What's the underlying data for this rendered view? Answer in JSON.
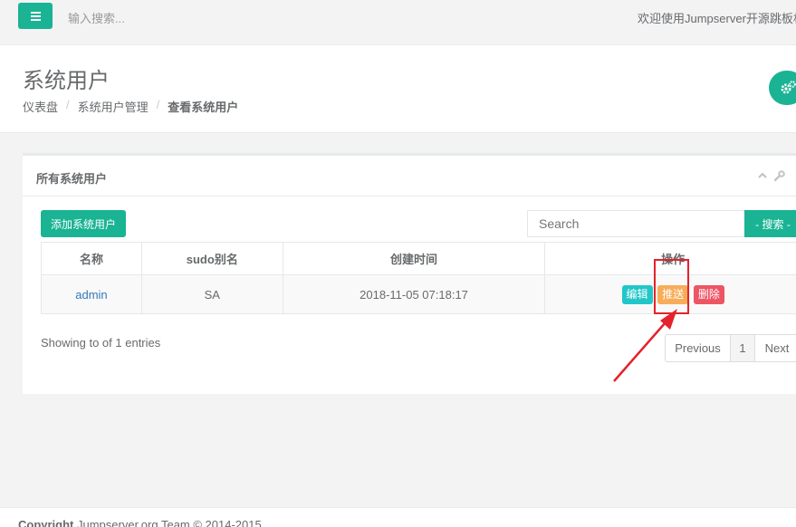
{
  "topbar": {
    "search_placeholder": "输入搜索...",
    "welcome_text": "欢迎使用Jumpserver开源跳板机"
  },
  "heading": {
    "title": "系统用户",
    "breadcrumb": [
      "仪表盘",
      "系统用户管理",
      "查看系统用户"
    ]
  },
  "panel": {
    "title": "所有系统用户",
    "add_button": "添加系统用户",
    "search_placeholder": "Search",
    "search_button": "- 搜索 -",
    "columns": [
      "名称",
      "sudo别名",
      "创建时间",
      "操作"
    ],
    "rows": [
      {
        "name": "admin",
        "sudo": "SA",
        "created": "2018-11-05 07:18:17",
        "actions": {
          "edit": "编辑",
          "push": "推送",
          "delete": "删除"
        }
      }
    ],
    "info": "Showing to of 1 entries",
    "pagination": {
      "prev": "Previous",
      "page": "1",
      "next": "Next"
    }
  },
  "footer": {
    "copy_bold": "Copyright",
    "copy_rest": " Jumpserver.org Team © 2014-2015"
  },
  "colors": {
    "primary": "#1ab394",
    "edit": "#23c6c8",
    "push": "#f8ac59",
    "delete": "#ed5565",
    "annotation": "#e4222b"
  },
  "icons": [
    "menu-icon",
    "gears-icon",
    "chevron-up-icon",
    "wrench-icon"
  ]
}
